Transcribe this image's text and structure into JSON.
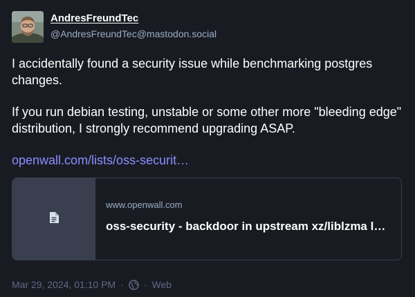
{
  "author": {
    "display_name": "AndresFreundTec",
    "handle": "@AndresFreundTec@mastodon.social",
    "avatar_icon": "profile-photo"
  },
  "content": {
    "paragraph_1": "I accidentally found a security issue while benchmarking postgres changes.",
    "paragraph_2": "If you run debian testing, unstable or some other more \"bleeding edge\" distribution, I strongly recommend upgrading ASAP.",
    "link_text": "openwall.com/lists/oss-securit…"
  },
  "card": {
    "domain": "www.openwall.com",
    "title": "oss-security - backdoor in upstream xz/liblzma leads to ssh server compromise",
    "thumb_icon": "document-icon"
  },
  "meta": {
    "timestamp": "Mar 29, 2024, 01:10 PM",
    "separator": "·",
    "visibility_icon": "globe-icon",
    "source": "Web"
  },
  "colors": {
    "background": "#191b22",
    "link": "#8c8dff",
    "muted": "#9baec8",
    "meta": "#606984",
    "card_border": "#393f4f"
  }
}
